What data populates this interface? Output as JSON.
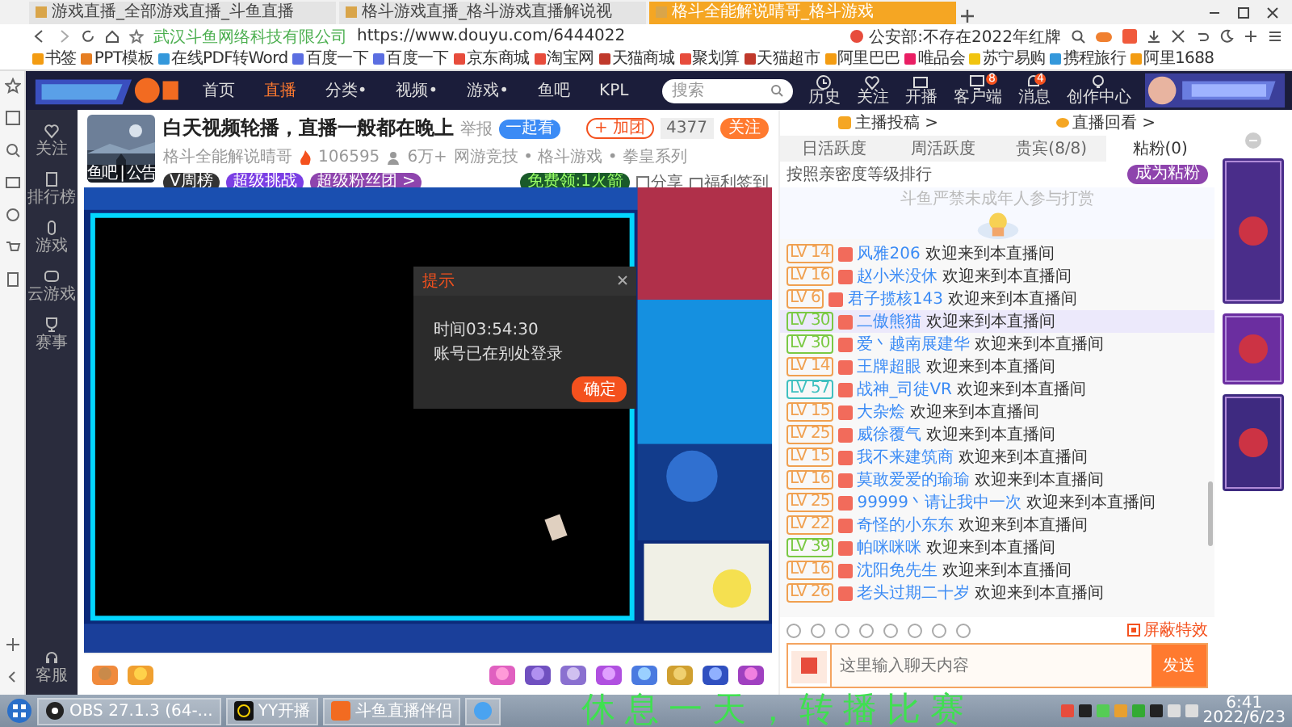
{
  "browser": {
    "tabs": [
      {
        "title": "游戏直播_全部游戏直播_斗鱼直播",
        "selected": false
      },
      {
        "title": "格斗游戏直播_格斗游戏直播解说视",
        "selected": false
      },
      {
        "title": "格斗全能解说晴哥_格斗游戏",
        "selected": true
      }
    ],
    "site_label": "武汉斗鱼网络科技有限公司",
    "url": "https://www.douyu.com/6444022",
    "search_text": "公安部:不存在2022年红牌",
    "bookmarks": [
      "书签",
      "PPT模板",
      "在线PDF转Word",
      "百度一下",
      "百度一下",
      "京东商城",
      "淘宝网",
      "天猫商城",
      "聚划算",
      "天猫超市",
      "阿里巴巴",
      "唯品会",
      "苏宁易购",
      "携程旅行",
      "阿里1688"
    ]
  },
  "header": {
    "nav": [
      {
        "label": "首页",
        "selected": false
      },
      {
        "label": "直播",
        "selected": true
      },
      {
        "label": "分类•",
        "selected": false
      },
      {
        "label": "视频•",
        "selected": false
      },
      {
        "label": "游戏•",
        "selected": false
      },
      {
        "label": "鱼吧",
        "selected": false
      },
      {
        "label": "KPL",
        "selected": false
      }
    ],
    "search": {
      "placeholder": "搜索"
    },
    "actions": [
      {
        "kind": "history",
        "label": "历史"
      },
      {
        "kind": "follow",
        "label": "关注"
      },
      {
        "kind": "live",
        "label": "开播"
      },
      {
        "kind": "client",
        "label": "客户端",
        "badge": "8"
      },
      {
        "kind": "message",
        "label": "消息",
        "badge": "4"
      },
      {
        "kind": "creator",
        "label": "创作中心"
      }
    ]
  },
  "site_rail": [
    {
      "kind": "heart",
      "label": "关注"
    },
    {
      "kind": "rank",
      "label": "排行榜"
    },
    {
      "kind": "game",
      "label": "游戏"
    },
    {
      "kind": "cloud",
      "label": "云游戏"
    },
    {
      "kind": "trophy",
      "label": "赛事"
    },
    {
      "kind": "service",
      "label": "客服"
    }
  ],
  "room": {
    "title": "白天视频轮播，直播一般都在晚上",
    "report": "举报",
    "watch_together": "一起看",
    "category": "网游竞技 • 格斗游戏 • 拳皇系列",
    "anchor": "格斗全能解说晴哥",
    "heat": "106595",
    "followers": "6万+",
    "avatar_caption": "鱼吧 | 公告",
    "badges": [
      "V周榜",
      "超级挑战",
      "超级粉丝团 >"
    ],
    "add_group": "+ 加团",
    "follow_count": "4377",
    "follow": "关注",
    "free_gift": "免费领:1火箭",
    "share": "分享",
    "checkin": "福利签到"
  },
  "player": {
    "dialog": {
      "title": "提示",
      "lines": [
        "时间03:54:30",
        "账号已在别处登录"
      ],
      "button": "确定"
    }
  },
  "chat": {
    "links": [
      "主播投稿 >",
      "直播回看 >"
    ],
    "tabs": [
      {
        "label": "日活跃度",
        "selected": false
      },
      {
        "label": "周活跃度",
        "selected": false
      },
      {
        "label": "贵宾(8/8)",
        "selected": false
      },
      {
        "label": "粘粉(0)",
        "selected": true
      }
    ],
    "rank_label": "按照亲密度等级排行",
    "join": "成为粘粉",
    "empty_note": "斗鱼严禁未成年人参与打赏",
    "messages": [
      {
        "level": "LV 14",
        "color": "#f0a050",
        "name": "风雅206",
        "text": "欢迎来到本直播间",
        "highlighted": false
      },
      {
        "level": "LV 16",
        "color": "#f0a050",
        "name": "赵小米没休",
        "text": "欢迎来到本直播间",
        "highlighted": false
      },
      {
        "level": "LV 6",
        "color": "#f0a050",
        "name": "君子揽核143",
        "text": "欢迎来到本直播间",
        "highlighted": false
      },
      {
        "level": "LV 30",
        "color": "#7ac943",
        "name": "二傲熊猫",
        "text": "欢迎来到本直播间",
        "highlighted": true
      },
      {
        "level": "LV 30",
        "color": "#7ac943",
        "name": "爱丶越南展建华",
        "text": "欢迎来到本直播间",
        "highlighted": false
      },
      {
        "level": "LV 14",
        "color": "#f0a050",
        "name": "王牌超眼",
        "text": "欢迎来到本直播间",
        "highlighted": false
      },
      {
        "level": "LV 57",
        "color": "#40c0c0",
        "name": "战神_司徒VR",
        "text": "欢迎来到本直播间",
        "highlighted": false
      },
      {
        "level": "LV 15",
        "color": "#f0a050",
        "name": "大杂烩",
        "text": "欢迎来到本直播间",
        "highlighted": false
      },
      {
        "level": "LV 25",
        "color": "#f0a050",
        "name": "威徐覆气",
        "text": "欢迎来到本直播间",
        "highlighted": false
      },
      {
        "level": "LV 15",
        "color": "#f0a050",
        "name": "我不来建筑商",
        "text": "欢迎来到本直播间",
        "highlighted": false
      },
      {
        "level": "LV 16",
        "color": "#f0a050",
        "name": "莫敢爱爱的瑜瑜",
        "text": "欢迎来到本直播间",
        "highlighted": false
      },
      {
        "level": "LV 25",
        "color": "#f0a050",
        "name": "99999丶请让我中一次",
        "text": "欢迎来到本直播间",
        "highlighted": false
      },
      {
        "level": "LV 22",
        "color": "#f0a050",
        "name": "奇怪的小东东",
        "text": "欢迎来到本直播间",
        "highlighted": false
      },
      {
        "level": "LV 39",
        "color": "#7ac943",
        "name": "帕咪咪咪",
        "text": "欢迎来到本直播间",
        "highlighted": false
      },
      {
        "level": "LV 16",
        "color": "#f0a050",
        "name": "沈阳免先生",
        "text": "欢迎来到本直播间",
        "highlighted": false
      },
      {
        "level": "LV 26",
        "color": "#f0a050",
        "name": "老头过期二十岁",
        "text": "欢迎来到本直播间",
        "highlighted": false
      }
    ],
    "effects_toggle": "屏蔽特效",
    "input": {
      "placeholder": "这里输入聊天内容"
    },
    "send": "发送"
  },
  "taskbar": {
    "apps": [
      {
        "kind": "obs",
        "label": "OBS 27.1.3 (64-..."
      },
      {
        "kind": "yy",
        "label": "YY开播"
      },
      {
        "kind": "douyu",
        "label": "斗鱼直播伴侣"
      },
      {
        "kind": "browser"
      }
    ],
    "time": "6:41",
    "date": "2022/6/23"
  },
  "caption": "休息一天，转播比赛"
}
